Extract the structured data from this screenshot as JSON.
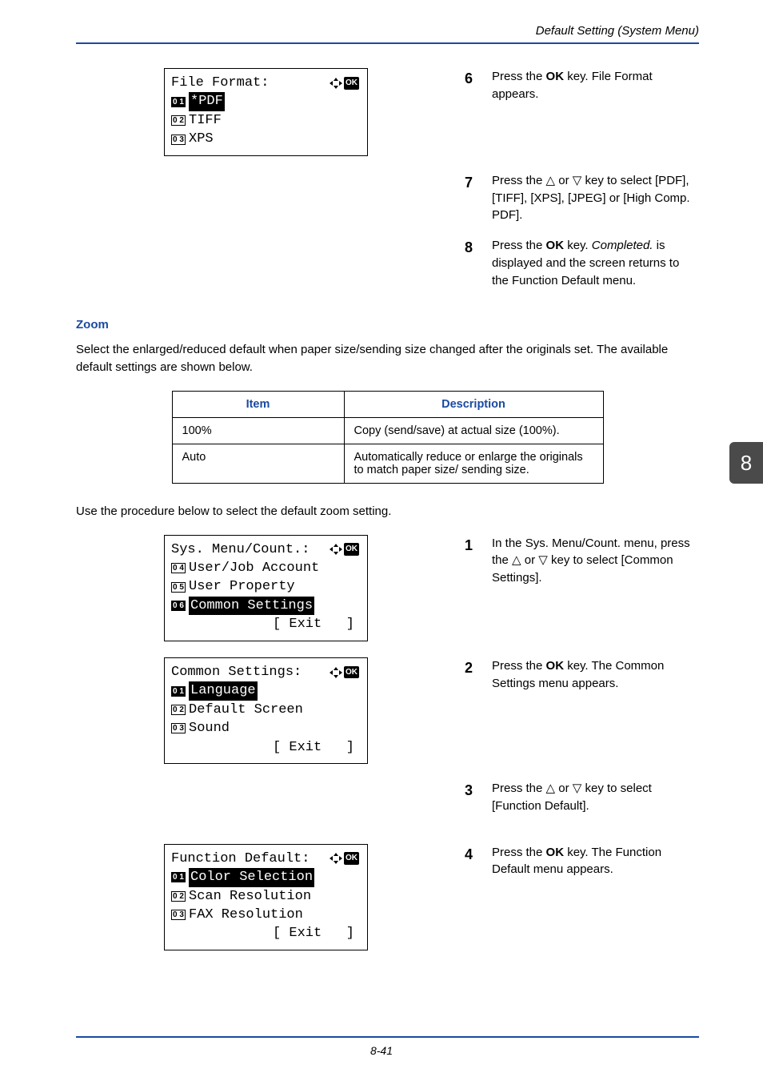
{
  "header": {
    "running": "Default Setting (System Menu)"
  },
  "sideTab": "8",
  "footer": {
    "page": "8-41"
  },
  "lcd_file_format": {
    "title": "File Format:",
    "items": [
      {
        "num": "0 1",
        "text": "*PDF",
        "selected": true
      },
      {
        "num": "0 2",
        "text": "TIFF",
        "selected": false
      },
      {
        "num": "0 3",
        "text": "XPS",
        "selected": false
      }
    ]
  },
  "steps_a": [
    {
      "n": "6",
      "html": "Press the <b>OK</b> key. File Format appears."
    },
    {
      "n": "7",
      "html": "Press the <span class='tri'>△</span> or <span class='tri'>▽</span> key to select [PDF], [TIFF], [XPS], [JPEG] or [High Comp. PDF]."
    },
    {
      "n": "8",
      "html": "Press the <b>OK</b> key. <i>Completed.</i> is displayed and the screen returns to the Function Default menu."
    }
  ],
  "zoom": {
    "heading": "Zoom",
    "intro": "Select the enlarged/reduced default when paper size/sending size changed after the originals set. The available default settings are shown below.",
    "table": {
      "headers": [
        "Item",
        "Description"
      ],
      "rows": [
        [
          "100%",
          "Copy (send/save) at actual size (100%)."
        ],
        [
          "Auto",
          "Automatically reduce or enlarge the originals to match paper size/ sending size."
        ]
      ]
    },
    "lead": "Use the procedure below to select the default zoom setting."
  },
  "lcd_sys_menu": {
    "title": "Sys. Menu/Count.:",
    "items": [
      {
        "num": "0 4",
        "text": "User/Job Account",
        "selected": false
      },
      {
        "num": "0 5",
        "text": "User Property",
        "selected": false
      },
      {
        "num": "0 6",
        "text": "Common Settings",
        "selected": true
      }
    ],
    "exit": "[ Exit   ]"
  },
  "lcd_common": {
    "title": "Common Settings:",
    "items": [
      {
        "num": "0 1",
        "text": "Language",
        "selected": true
      },
      {
        "num": "0 2",
        "text": "Default Screen",
        "selected": false
      },
      {
        "num": "0 3",
        "text": "Sound",
        "selected": false
      }
    ],
    "exit": "[ Exit   ]"
  },
  "lcd_func_default": {
    "title": "Function Default:",
    "items": [
      {
        "num": "0 1",
        "text": "Color Selection",
        "selected": true
      },
      {
        "num": "0 2",
        "text": "Scan Resolution",
        "selected": false
      },
      {
        "num": "0 3",
        "text": "FAX Resolution",
        "selected": false
      }
    ],
    "exit": "[ Exit   ]"
  },
  "steps_b": [
    {
      "n": "1",
      "html": "In the Sys. Menu/Count. menu, press the <span class='tri'>△</span> or <span class='tri'>▽</span> key to select [Common Settings]."
    },
    {
      "n": "2",
      "html": "Press the <b>OK</b> key. The Common Settings menu appears."
    },
    {
      "n": "3",
      "html": "Press the <span class='tri'>△</span> or <span class='tri'>▽</span> key to select [Function Default]."
    },
    {
      "n": "4",
      "html": "Press the <b>OK</b> key. The Function Default menu appears."
    }
  ]
}
